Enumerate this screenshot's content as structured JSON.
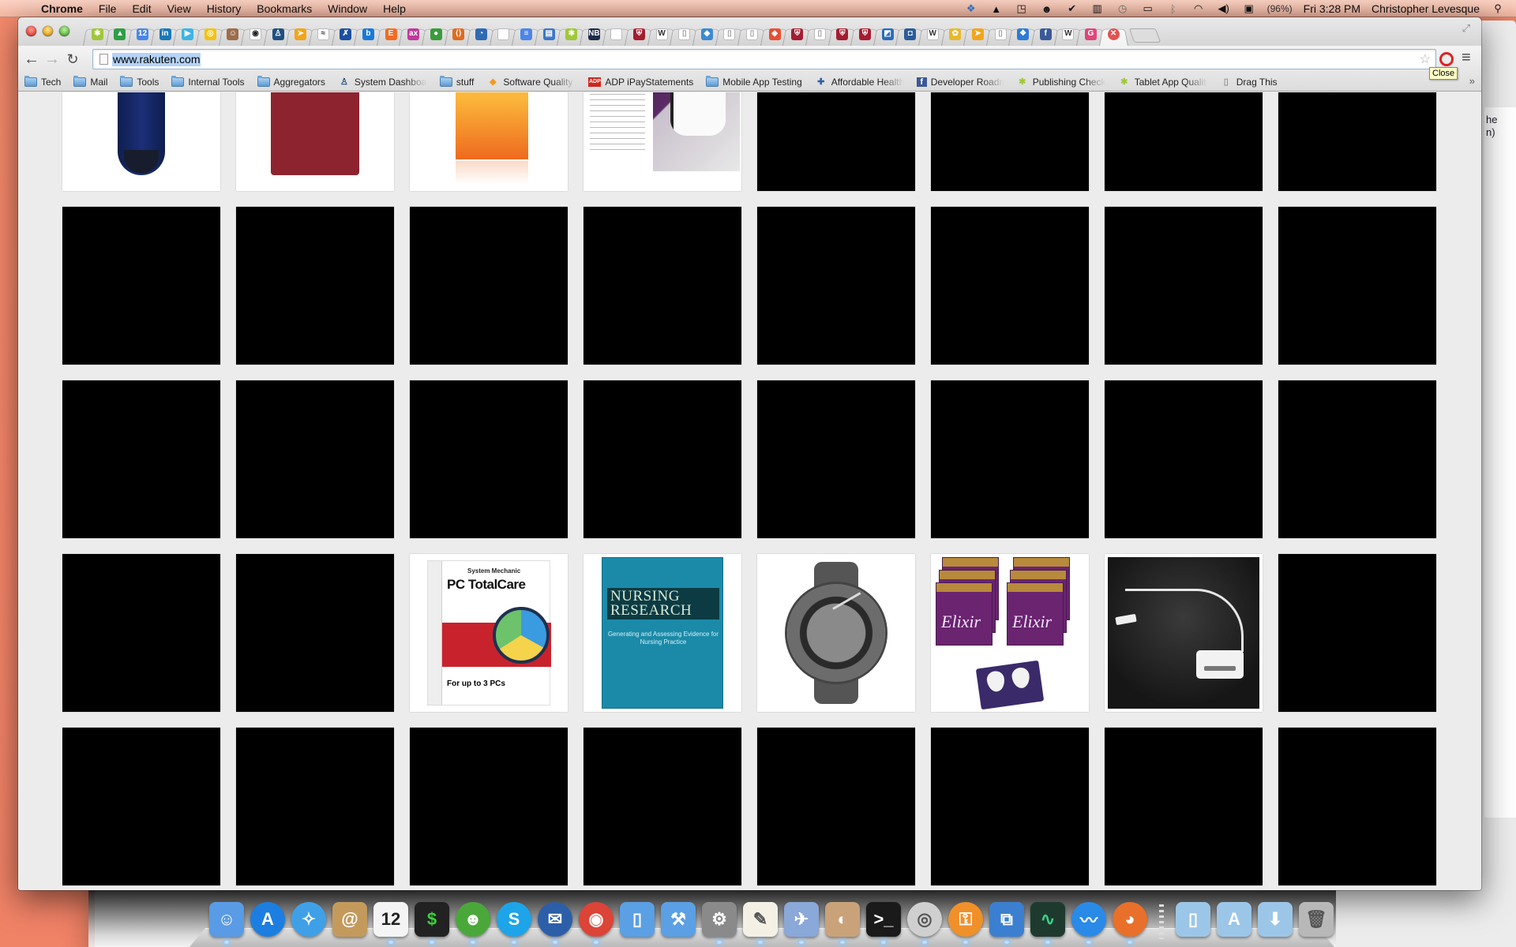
{
  "menubar": {
    "app_name": "Chrome",
    "items": [
      "File",
      "Edit",
      "View",
      "History",
      "Bookmarks",
      "Window",
      "Help"
    ],
    "status_icons": [
      {
        "name": "dropbox-icon",
        "glyph": "❖",
        "color": "#2d7bd6"
      },
      {
        "name": "google-drive-icon",
        "glyph": "▲",
        "color": "#111111"
      },
      {
        "name": "screen-share-icon",
        "glyph": "◳",
        "color": "#111111"
      },
      {
        "name": "adium-icon",
        "glyph": "☻",
        "color": "#111111"
      },
      {
        "name": "checkmark-badge-icon",
        "glyph": "✔",
        "color": "#111111"
      },
      {
        "name": "battery-monitor-icon",
        "glyph": "▥",
        "color": "#111111"
      },
      {
        "name": "time-machine-icon",
        "glyph": "◷",
        "color": "#777777"
      },
      {
        "name": "display-icon",
        "glyph": "▭",
        "color": "#111111"
      },
      {
        "name": "bluetooth-icon",
        "glyph": "ᛒ",
        "color": "#888888"
      },
      {
        "name": "wifi-icon",
        "glyph": "◠",
        "color": "#111111"
      },
      {
        "name": "volume-icon",
        "glyph": "◀)",
        "color": "#111111"
      },
      {
        "name": "battery-icon",
        "glyph": "▣",
        "color": "#111111"
      }
    ],
    "battery_percent": "(96%)",
    "clock": "Fri 3:28 PM",
    "user": "Christopher Levesque",
    "spotlight_glyph": "⚲"
  },
  "browser": {
    "tabs": [
      {
        "icon": "android-icon",
        "glyph": "✱",
        "color": "#9fc83a"
      },
      {
        "icon": "google-drive-icon",
        "glyph": "▲",
        "color": "#2f9e48"
      },
      {
        "icon": "calendar-icon",
        "glyph": "12",
        "color": "#4a86e8"
      },
      {
        "icon": "linkedin-icon",
        "glyph": "in",
        "color": "#1a78b8"
      },
      {
        "icon": "google-play-icon",
        "glyph": "▶",
        "color": "#3cb4e6"
      },
      {
        "icon": "yellow-circle-icon",
        "glyph": "◎",
        "color": "#f4c20d"
      },
      {
        "icon": "jenkins-icon",
        "glyph": "☺",
        "color": "#9c6d4b"
      },
      {
        "icon": "github-icon",
        "glyph": "◉",
        "color": "#222222"
      },
      {
        "icon": "jira-icon",
        "glyph": "♙",
        "color": "#205081"
      },
      {
        "icon": "arrow-icon",
        "glyph": "➤",
        "color": "#f2a51a"
      },
      {
        "icon": "waves-icon",
        "glyph": "≈",
        "color": "#333333"
      },
      {
        "icon": "x-logo-icon",
        "glyph": "✗",
        "color": "#1c4fa0"
      },
      {
        "icon": "b-logo-icon",
        "glyph": "b",
        "color": "#1a7ad4"
      },
      {
        "icon": "e-logo-icon",
        "glyph": "E",
        "color": "#f36b21"
      },
      {
        "icon": "adx-icon",
        "glyph": "ax",
        "color": "#c0399b"
      },
      {
        "icon": "leaf-icon",
        "glyph": "●",
        "color": "#3b9b3b"
      },
      {
        "icon": "bracket-icon",
        "glyph": "⟨⟩",
        "color": "#e06b1f"
      },
      {
        "icon": "swirl-icon",
        "glyph": "◔",
        "color": "#2e6ab3"
      },
      {
        "icon": "apple-icon",
        "glyph": "",
        "color": "#888888"
      },
      {
        "icon": "docs-icon",
        "glyph": "≡",
        "color": "#4a86e8"
      },
      {
        "icon": "window-icon",
        "glyph": "▤",
        "color": "#3a78c6"
      },
      {
        "icon": "android-icon",
        "glyph": "✱",
        "color": "#9fc83a"
      },
      {
        "icon": "nbc-icon",
        "glyph": "NB",
        "color": "#1e2a4a"
      },
      {
        "icon": "apple-icon",
        "glyph": "",
        "color": "#888888"
      },
      {
        "icon": "harvard-shield-icon",
        "glyph": "⛨",
        "color": "#a51c30"
      },
      {
        "icon": "wikipedia-icon",
        "glyph": "W",
        "color": "#333333"
      },
      {
        "icon": "page-icon",
        "glyph": "▯",
        "color": "#999999"
      },
      {
        "icon": "diamond-icon",
        "glyph": "◆",
        "color": "#3a8ad4"
      },
      {
        "icon": "page-icon",
        "glyph": "▯",
        "color": "#999999"
      },
      {
        "icon": "page-icon",
        "glyph": "▯",
        "color": "#999999"
      },
      {
        "icon": "git-icon",
        "glyph": "◆",
        "color": "#e94e31"
      },
      {
        "icon": "harvard-shield-icon",
        "glyph": "⛨",
        "color": "#a51c30"
      },
      {
        "icon": "page-icon",
        "glyph": "▯",
        "color": "#999999"
      },
      {
        "icon": "harvard-shield-icon",
        "glyph": "⛨",
        "color": "#a51c30"
      },
      {
        "icon": "harvard-shield-icon",
        "glyph": "⛨",
        "color": "#a51c30"
      },
      {
        "icon": "chart-icon",
        "glyph": "◩",
        "color": "#2a6cb8"
      },
      {
        "icon": "bucket-icon",
        "glyph": "◘",
        "color": "#2a5c9a"
      },
      {
        "icon": "wikipedia-icon",
        "glyph": "W",
        "color": "#333333"
      },
      {
        "icon": "flower-icon",
        "glyph": "✿",
        "color": "#e8b92a"
      },
      {
        "icon": "arrow-icon",
        "glyph": "➤",
        "color": "#f2a51a"
      },
      {
        "icon": "page-icon",
        "glyph": "▯",
        "color": "#999999"
      },
      {
        "icon": "dropbox-icon",
        "glyph": "❖",
        "color": "#2d7bd6"
      },
      {
        "icon": "facebook-icon",
        "glyph": "f",
        "color": "#3b5998"
      },
      {
        "icon": "wikipedia-icon",
        "glyph": "W",
        "color": "#333333"
      },
      {
        "icon": "g-logo-icon",
        "glyph": "G",
        "color": "#e0457b"
      },
      {
        "icon": "close-tab-icon",
        "glyph": "✕",
        "color": "#e05252",
        "active": true
      }
    ],
    "tooltip": "Close",
    "url": "www.rakuten.com",
    "bookmarks": [
      {
        "label": "Tech",
        "icon": "folder-icon",
        "fade": false
      },
      {
        "label": "Mail",
        "icon": "folder-icon",
        "fade": false
      },
      {
        "label": "Tools",
        "icon": "folder-icon",
        "fade": false
      },
      {
        "label": "Internal Tools",
        "icon": "folder-icon",
        "fade": false
      },
      {
        "label": "Aggregators",
        "icon": "folder-icon",
        "fade": false
      },
      {
        "label": "System Dashboard -",
        "icon": "jira-icon",
        "glyph": "♙",
        "color": "#205081",
        "fade": true
      },
      {
        "label": "stuff",
        "icon": "folder-icon",
        "fade": false
      },
      {
        "label": "Software Quality Ass",
        "icon": "diamond-icon",
        "glyph": "◆",
        "color": "#f29a1f",
        "fade": true
      },
      {
        "label": "ADP iPayStatements",
        "icon": "adp-icon",
        "glyph": "ADP",
        "color": "#d0271d",
        "fade": false
      },
      {
        "label": "Mobile App Testing",
        "icon": "folder-icon",
        "fade": false
      },
      {
        "label": "Affordable Health Ins",
        "icon": "bluecross-icon",
        "glyph": "✚",
        "color": "#2f5ea8",
        "fade": true
      },
      {
        "label": "Developer Roadmap",
        "icon": "facebook-icon",
        "glyph": "f",
        "color": "#3b5998",
        "fade": true
      },
      {
        "label": "Publishing Checklist",
        "icon": "android-icon",
        "glyph": "✱",
        "color": "#9fc83a",
        "fade": true
      },
      {
        "label": "Tablet App Quality C",
        "icon": "android-icon",
        "glyph": "✱",
        "color": "#9fc83a",
        "fade": true
      },
      {
        "label": "Drag This",
        "icon": "page-icon",
        "glyph": "▯",
        "color": "#999999",
        "fade": false
      }
    ],
    "bookmarks_overflow": "»"
  },
  "page": {
    "columns": 8,
    "rows": [
      [
        "guitar-gig-bag",
        "red-t-shirt",
        "office-software-box",
        "dog-flea-treatment",
        null,
        null,
        null,
        null
      ],
      [
        null,
        null,
        null,
        null,
        null,
        null,
        null,
        null
      ],
      [
        null,
        null,
        null,
        null,
        null,
        null,
        null,
        null
      ],
      [
        null,
        null,
        "pc-totalcare-software",
        "nursing-research-book",
        "gray-dive-watch",
        "elixir-guitar-strings",
        "dock-connector-adapter",
        null
      ],
      [
        null,
        null,
        null,
        null,
        null,
        null,
        null,
        null
      ]
    ],
    "products": {
      "pc-totalcare-software": {
        "brand": "System Mechanic",
        "title": "PC TotalCare",
        "footer": "For up to 3 PCs"
      },
      "nursing-research-book": {
        "title": "NURSING RESEARCH",
        "subtitle": "Generating and Assessing Evidence for Nursing Practice"
      },
      "elixir-guitar-strings": {
        "brand": "Elixir"
      }
    }
  },
  "background_window": {
    "text_lines": [
      "he",
      "n)"
    ]
  },
  "dock": {
    "items": [
      {
        "name": "finder-icon",
        "glyph": "☺",
        "bg": "#5a9be6",
        "running": true
      },
      {
        "name": "app-store-icon",
        "glyph": "A",
        "bg": "#1c7ee0",
        "round": true,
        "running": false
      },
      {
        "name": "safari-icon",
        "glyph": "✧",
        "bg": "#3fa0e8",
        "round": true,
        "running": false
      },
      {
        "name": "address-book-icon",
        "glyph": "@",
        "bg": "#c49a5c",
        "running": false
      },
      {
        "name": "calendar-icon",
        "glyph": "12",
        "bg": "#f4f4f4",
        "fg": "#222",
        "running": true
      },
      {
        "name": "terminal-icon",
        "glyph": "$",
        "bg": "#222222",
        "fg": "#3ad23a",
        "running": true
      },
      {
        "name": "adium-icon",
        "glyph": "☻",
        "bg": "#4aa83a",
        "round": true,
        "running": true
      },
      {
        "name": "skype-icon",
        "glyph": "S",
        "bg": "#1ea4e8",
        "round": true,
        "running": true
      },
      {
        "name": "thunderbird-icon",
        "glyph": "✉",
        "bg": "#2c5fa8",
        "round": true,
        "running": true
      },
      {
        "name": "chrome-icon",
        "glyph": "◉",
        "bg": "#db4437",
        "round": true,
        "running": true
      },
      {
        "name": "ios-simulator-icon",
        "glyph": "▯",
        "bg": "#5b9fe4",
        "running": false
      },
      {
        "name": "xcode-icon",
        "glyph": "⚒",
        "bg": "#5b9fe4",
        "running": false
      },
      {
        "name": "system-preferences-icon",
        "glyph": "⚙",
        "bg": "#8a8a8a",
        "running": true
      },
      {
        "name": "textedit-icon",
        "glyph": "✎",
        "bg": "#f4f0e4",
        "fg": "#555",
        "running": true
      },
      {
        "name": "mail-icon",
        "glyph": "✈",
        "bg": "#8aa8d8",
        "running": true
      },
      {
        "name": "preview-icon",
        "glyph": "◐",
        "bg": "#c9a27a",
        "running": true
      },
      {
        "name": "terminal-alt-icon",
        "glyph": ">_",
        "bg": "#1a1a1a",
        "running": true
      },
      {
        "name": "dvd-player-icon",
        "glyph": "◎",
        "bg": "#cfcfcf",
        "fg": "#555",
        "round": true,
        "running": true
      },
      {
        "name": "keychain-icon",
        "glyph": "⚿",
        "bg": "#f0902a",
        "round": true,
        "running": true
      },
      {
        "name": "vmware-icon",
        "glyph": "⧉",
        "bg": "#3b7fd0",
        "running": true
      },
      {
        "name": "activity-monitor-icon",
        "glyph": "∿",
        "bg": "#1e3a2e",
        "fg": "#3ad28a",
        "running": true
      },
      {
        "name": "openoffice-icon",
        "glyph": "〰",
        "bg": "#2a8ae8",
        "round": true,
        "running": true
      },
      {
        "name": "firefox-icon",
        "glyph": "◕",
        "bg": "#e8702a",
        "round": true,
        "running": true
      },
      {
        "name": "documents-folder-icon",
        "glyph": "▯",
        "bg": "#9cc6e8",
        "running": false,
        "after_sep": true
      },
      {
        "name": "applications-folder-icon",
        "glyph": "A",
        "bg": "#9cc6e8",
        "running": false
      },
      {
        "name": "downloads-folder-icon",
        "glyph": "⬇",
        "bg": "#9cc6e8",
        "running": false
      },
      {
        "name": "trash-icon",
        "glyph": "🗑",
        "bg": "#b8b8b8",
        "fg": "#555",
        "running": false
      }
    ]
  },
  "colors": {
    "desktop": "#f7866a",
    "page_bg": "#ececec",
    "url_selection": "#b4d3f7"
  }
}
